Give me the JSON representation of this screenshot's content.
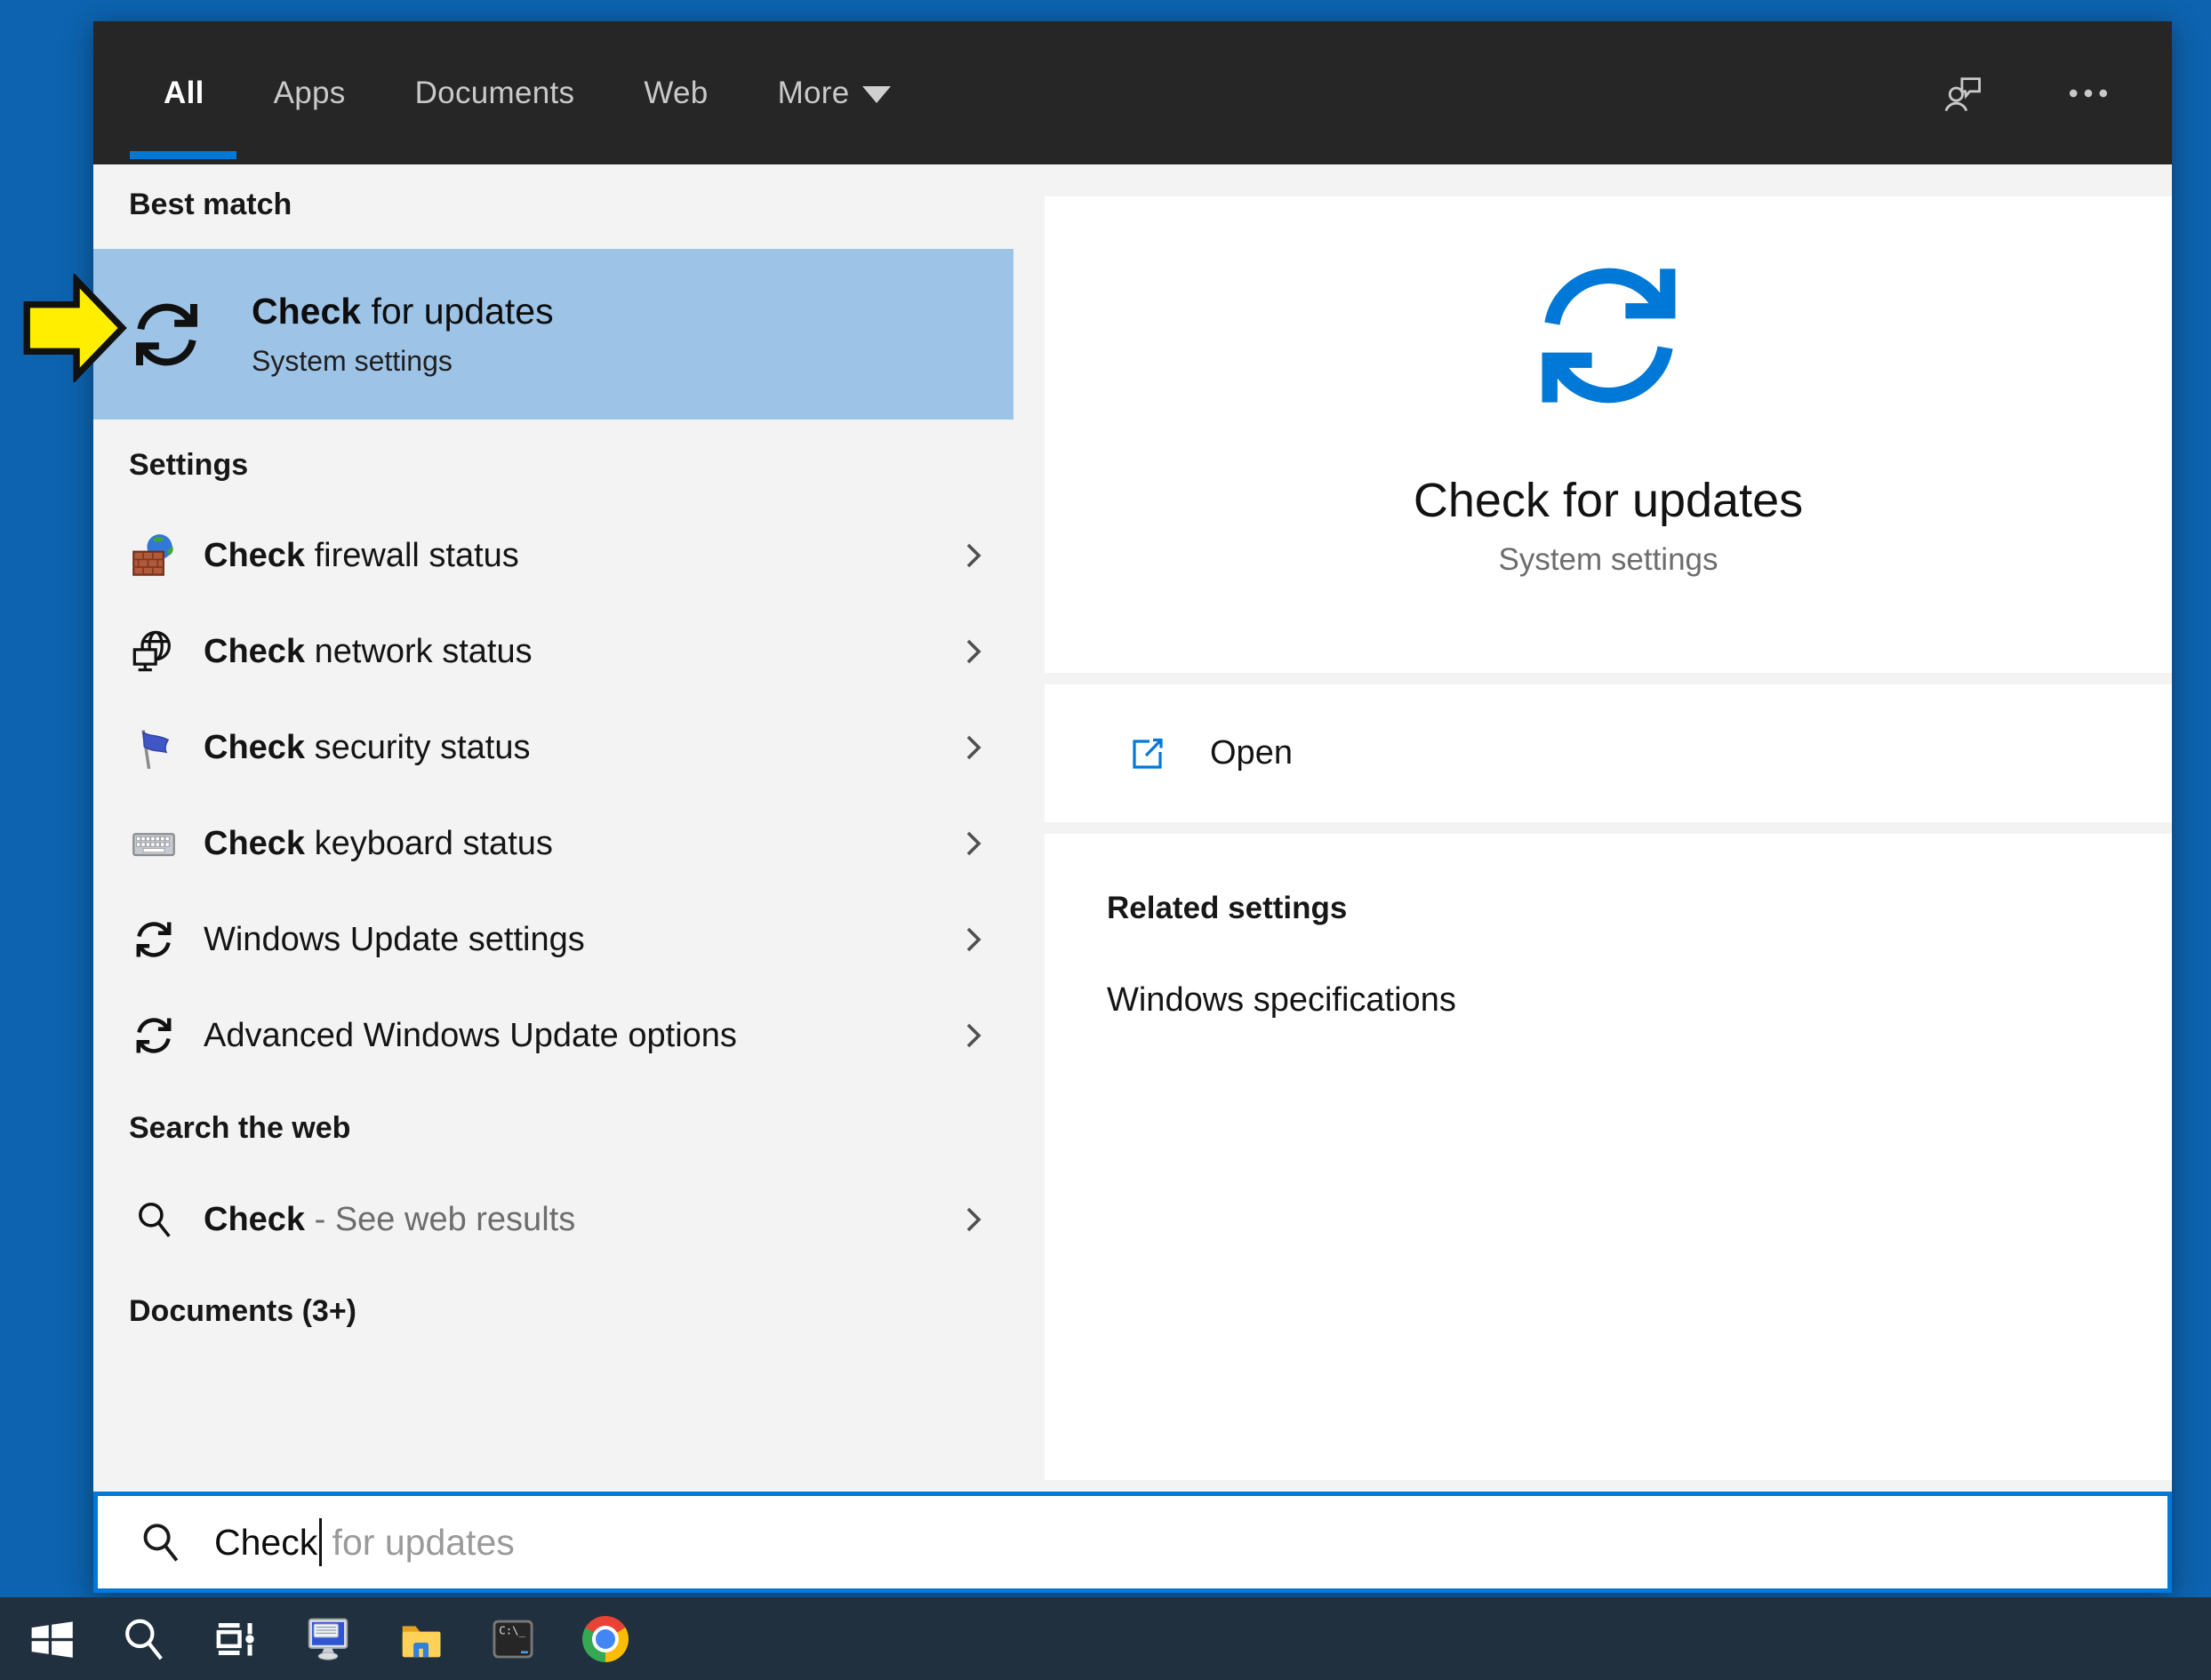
{
  "tabs": {
    "items": [
      {
        "label": "All",
        "active": true
      },
      {
        "label": "Apps",
        "active": false
      },
      {
        "label": "Documents",
        "active": false
      },
      {
        "label": "Web",
        "active": false
      },
      {
        "label": "More",
        "active": false,
        "has_dropdown": true
      }
    ]
  },
  "header_icons": [
    "user-feedback-icon",
    "ellipsis-icon"
  ],
  "left": {
    "best_match": {
      "header": "Best match",
      "item": {
        "title_bold": "Check",
        "title_rest": " for updates",
        "subtitle": "System settings",
        "icon": "sync-icon"
      }
    },
    "settings": {
      "header": "Settings",
      "items": [
        {
          "bold": "Check",
          "rest": " firewall status",
          "icon": "firewall-icon"
        },
        {
          "bold": "Check",
          "rest": " network status",
          "icon": "network-globe-icon"
        },
        {
          "bold": "Check",
          "rest": " security status",
          "icon": "security-flag-icon"
        },
        {
          "bold": "Check",
          "rest": " keyboard status",
          "icon": "keyboard-icon"
        },
        {
          "bold": "",
          "rest": "Windows Update settings",
          "icon": "sync-icon"
        },
        {
          "bold": "",
          "rest": "Advanced Windows Update options",
          "icon": "sync-icon"
        }
      ]
    },
    "web": {
      "header": "Search the web",
      "item": {
        "bold": "Check",
        "rest": " - See web results",
        "icon": "search-icon"
      }
    },
    "documents_header": "Documents (3+)"
  },
  "right": {
    "hero": {
      "title": "Check for updates",
      "subtitle": "System settings",
      "icon": "sync-icon"
    },
    "open": {
      "label": "Open",
      "icon": "open-external-icon"
    },
    "related": {
      "header": "Related settings",
      "link": "Windows specifications"
    }
  },
  "search": {
    "typed": "Check",
    "suggestion": " for updates",
    "icon": "search-icon"
  },
  "taskbar": {
    "icons": [
      "windows-start",
      "search",
      "task-view",
      "remote-desktop",
      "file-explorer",
      "command-prompt",
      "chrome"
    ],
    "cmd_text": "C:\\_"
  },
  "annotation": {
    "type": "yellow-arrow",
    "points_at": "best-match-item"
  },
  "colors": {
    "accent": "#0078d7",
    "desktop": "#0d63af",
    "highlight": "#9dc3e7",
    "taskbar": "#20303e",
    "header-bg": "#262626",
    "panel-bg": "#f3f3f3",
    "arrow": "#ffee00"
  }
}
